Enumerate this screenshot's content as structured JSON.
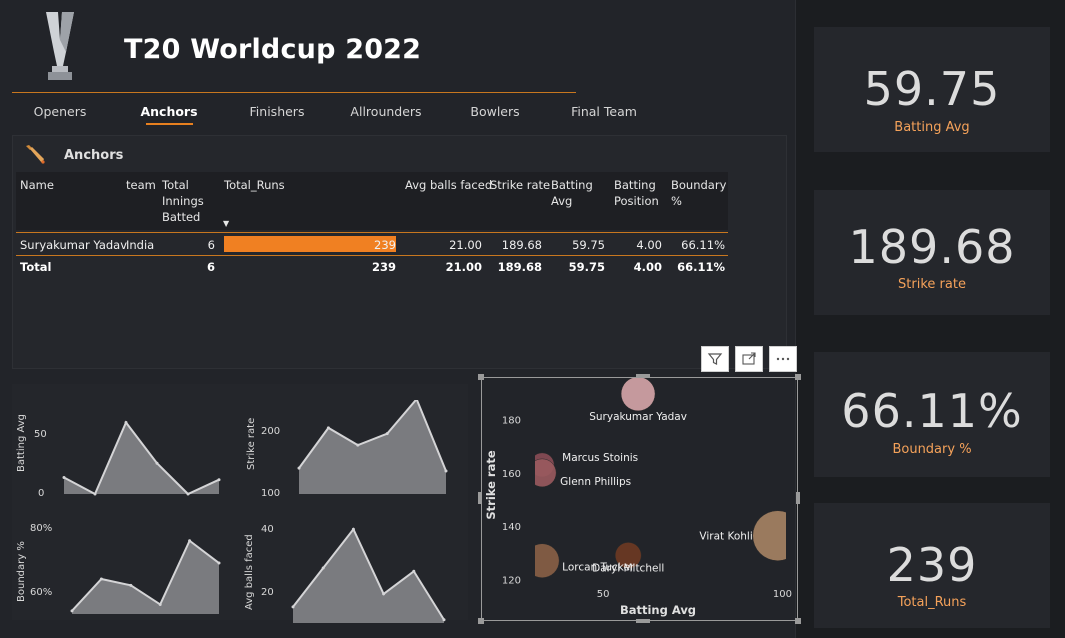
{
  "header": {
    "title": "T20 Worldcup 2022"
  },
  "tabs": [
    {
      "label": "Openers",
      "active": false
    },
    {
      "label": "Anchors",
      "active": true
    },
    {
      "label": "Finishers",
      "active": false
    },
    {
      "label": "Allrounders",
      "active": false
    },
    {
      "label": "Bowlers",
      "active": false
    },
    {
      "label": "Final Team",
      "active": false
    }
  ],
  "table": {
    "title": "Anchors",
    "columns": [
      "Name",
      "team",
      "Total Innings Batted",
      "Total_Runs",
      "Avg balls faced",
      "Strike rate",
      "Batting Avg",
      "Batting Position",
      "Boundary %"
    ],
    "rows": [
      {
        "name": "Suryakumar Yadav",
        "team": "India",
        "innings": "6",
        "runs": "239",
        "avg_balls": "21.00",
        "strike_rate": "189.68",
        "batting_avg": "59.75",
        "position": "4.00",
        "boundary": "66.11%"
      }
    ],
    "total": {
      "label": "Total",
      "innings": "6",
      "runs": "239",
      "avg_balls": "21.00",
      "strike_rate": "189.68",
      "batting_avg": "59.75",
      "position": "4.00",
      "boundary": "66.11%"
    }
  },
  "kpis": [
    {
      "value": "59.75",
      "label": "Batting Avg"
    },
    {
      "value": "189.68",
      "label": "Strike rate"
    },
    {
      "value": "66.11%",
      "label": "Boundary %"
    },
    {
      "value": "239",
      "label": "Total_Runs"
    }
  ],
  "colors": {
    "accent": "#f08022",
    "kpi_label": "#f5a25a",
    "area_fill": "#7a7b7f"
  },
  "chart_data": [
    {
      "type": "area",
      "ylabel": "Batting Avg",
      "y_ticks": [
        "50",
        "0"
      ],
      "ylim": [
        0,
        80
      ],
      "values": [
        15,
        0,
        65,
        28,
        0,
        13
      ]
    },
    {
      "type": "area",
      "ylabel": "Strike rate",
      "y_ticks": [
        "200",
        "100"
      ],
      "ylim": [
        100,
        260
      ],
      "values": [
        145,
        215,
        185,
        205,
        265,
        140
      ]
    },
    {
      "type": "area",
      "ylabel": "Boundary %",
      "y_ticks": [
        "80%",
        "60%"
      ],
      "ylim": [
        0.55,
        0.82
      ],
      "values": [
        0.56,
        0.66,
        0.64,
        0.58,
        0.78,
        0.71
      ]
    },
    {
      "type": "area",
      "ylabel": "Avg balls faced",
      "y_ticks": [
        "40",
        "20"
      ],
      "ylim": [
        10,
        40
      ],
      "values": [
        15,
        27,
        39,
        19,
        26,
        11
      ]
    },
    {
      "type": "scatter",
      "xlabel": "Batting Avg",
      "ylabel": "Strike rate",
      "xlim": [
        31,
        101
      ],
      "ylim": [
        113,
        193
      ],
      "x_ticks": [
        "50",
        "100"
      ],
      "y_ticks": [
        "180",
        "160",
        "140",
        "120"
      ],
      "points": [
        {
          "label": "Suryakumar Yadav",
          "x": 59.75,
          "y": 189.68,
          "color": "#d7a6aa"
        },
        {
          "label": "Marcus Stoinis",
          "x": 33,
          "y": 163,
          "color": "#8a4c55"
        },
        {
          "label": "Glenn Phillips",
          "x": 33,
          "y": 160,
          "color": "#9a5a5e"
        },
        {
          "label": "Daryl Mitchell",
          "x": 57,
          "y": 129,
          "color": "#6e3a22"
        },
        {
          "label": "Lorcan Tucker",
          "x": 33,
          "y": 127,
          "color": "#8a6046"
        },
        {
          "label": "Virat Kohli",
          "x": 98.7,
          "y": 136.4,
          "color": "#a78464"
        }
      ]
    }
  ]
}
